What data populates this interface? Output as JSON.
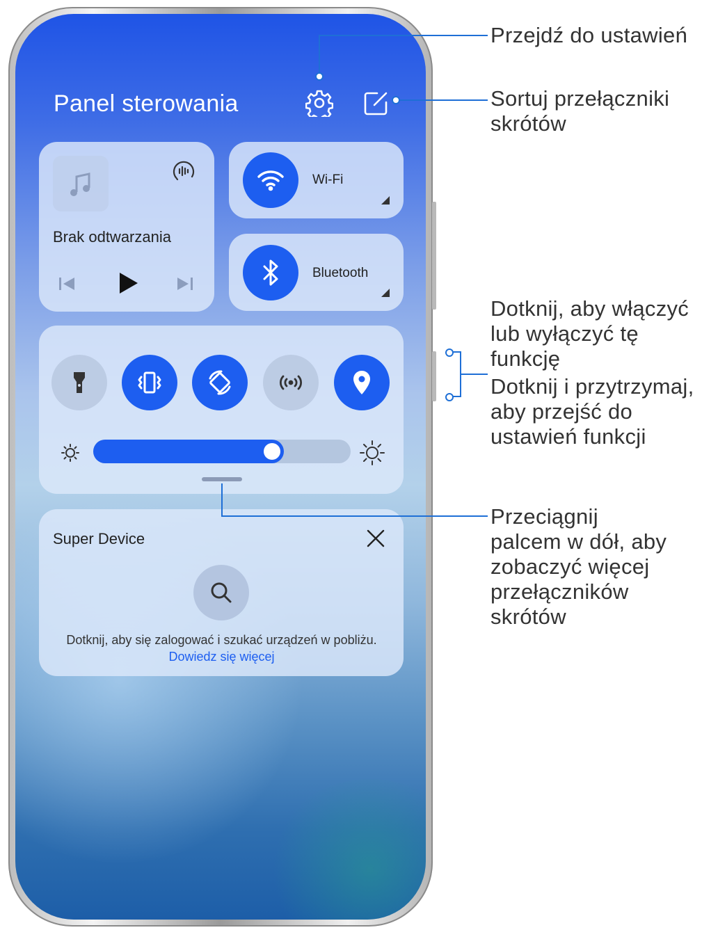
{
  "panel": {
    "title": "Panel sterowania",
    "settings_icon": "gear-icon",
    "edit_icon": "edit-icon"
  },
  "media": {
    "status": "Brak odtwarzania",
    "icons": [
      "music-note-icon",
      "audio-output-icon",
      "previous-icon",
      "play-icon",
      "next-icon"
    ]
  },
  "tiles": [
    {
      "label": "Wi-Fi",
      "icon": "wifi-icon",
      "state": "on"
    },
    {
      "label": "Bluetooth",
      "icon": "bluetooth-icon",
      "state": "on"
    }
  ],
  "shortcuts": [
    {
      "icon": "flashlight-icon",
      "state": "off"
    },
    {
      "icon": "vibrate-icon",
      "state": "on"
    },
    {
      "icon": "auto-rotate-icon",
      "state": "on"
    },
    {
      "icon": "nfc-icon",
      "state": "off"
    },
    {
      "icon": "location-icon",
      "state": "on"
    }
  ],
  "brightness": {
    "level": 0.74,
    "min_icon": "brightness-low-icon",
    "max_icon": "brightness-high-icon"
  },
  "super_device": {
    "title": "Super Device",
    "description": "Dotknij, aby się zalogować i szukać urządzeń w pobliżu.",
    "link": "Dowiedz się więcej",
    "icons": [
      "close-icon",
      "search-icon"
    ]
  },
  "callouts": {
    "settings": "Przejdź do ustawień",
    "sort_line1": "Sortuj przełączniki",
    "sort_line2": "skrótów",
    "toggle_line1": "Dotknij, aby włączyć",
    "toggle_line2": "lub wyłączyć tę",
    "toggle_line3": "funkcję",
    "hold_line1": "Dotknij i przytrzymaj,",
    "hold_line2": "aby przejść do",
    "hold_line3": "ustawień funkcji",
    "swipe_line1": "Przeciągnij",
    "swipe_line2": "palcem w dół, aby",
    "swipe_line3": "zobaczyć więcej",
    "swipe_line4": "przełączników",
    "swipe_line5": "skrótów"
  },
  "colors": {
    "accent": "#1d5ef0",
    "leader": "#1e6fd6"
  }
}
